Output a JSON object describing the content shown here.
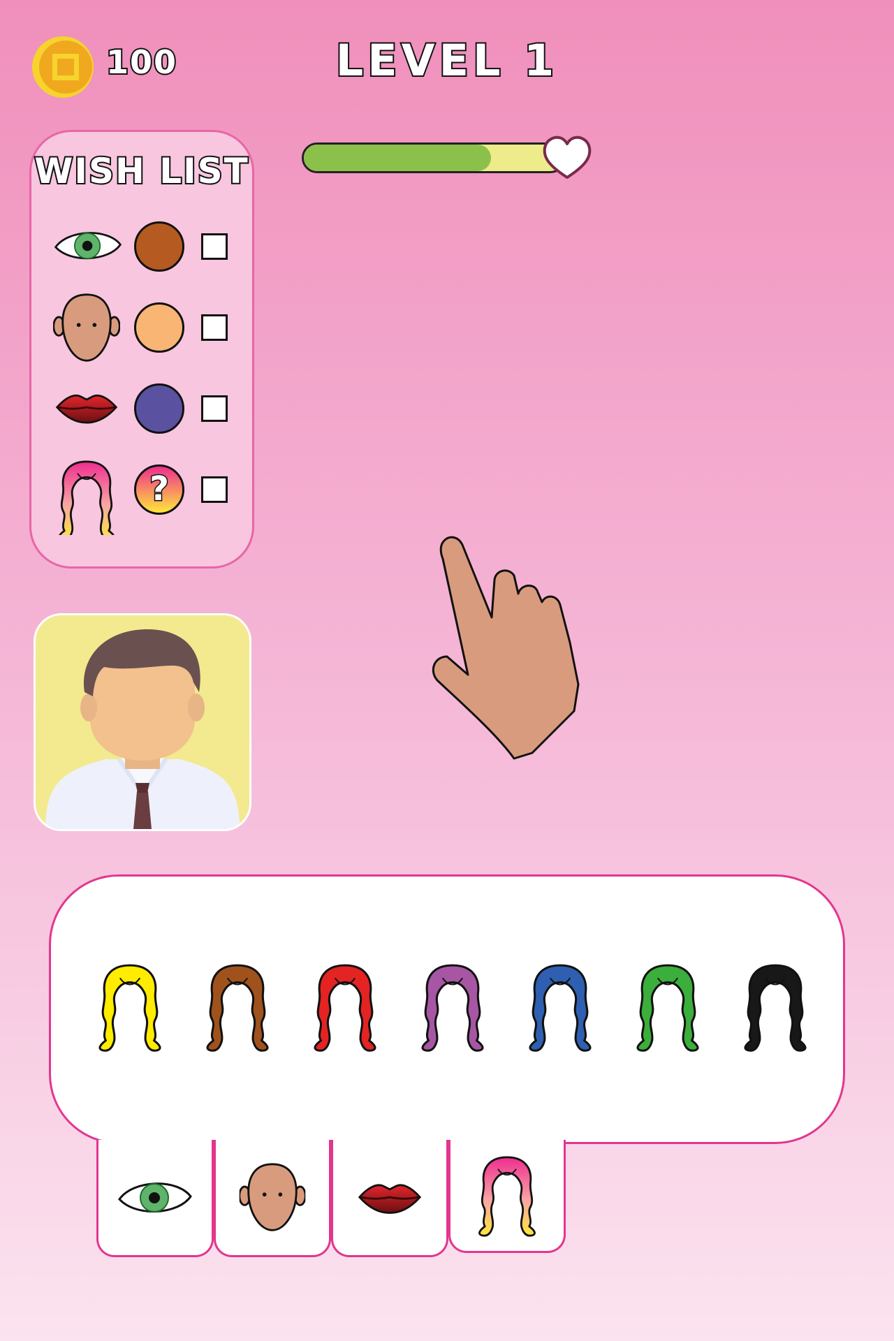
{
  "header": {
    "coins": "100",
    "level_title": "LEVEL 1"
  },
  "progress": {
    "value": 0.72
  },
  "wishlist": {
    "title": "WISH LIST",
    "items": [
      {
        "feature": "eye-icon",
        "color": "#b55a20",
        "swatch_icon": "",
        "checked": false
      },
      {
        "feature": "face-icon",
        "color": "#f8b574",
        "swatch_icon": "",
        "checked": false
      },
      {
        "feature": "lips-icon",
        "color": "#5a52a0",
        "swatch_icon": "",
        "checked": false
      },
      {
        "feature": "hair-icon",
        "color": "gradient-pink-yellow",
        "swatch_icon": "question-mark-icon",
        "checked": false
      }
    ],
    "unknown_symbol": "?"
  },
  "hair_options": [
    {
      "color": "#ffec00"
    },
    {
      "color": "#a0521c"
    },
    {
      "color": "#e42323"
    },
    {
      "color": "#a756a4"
    },
    {
      "color": "#2e5fb0"
    },
    {
      "color": "#3bae3b"
    },
    {
      "color": "#181818"
    }
  ],
  "tabs": [
    {
      "icon": "eye-icon"
    },
    {
      "icon": "face-icon"
    },
    {
      "icon": "lips-icon"
    },
    {
      "icon": "hair-icon",
      "active": true
    }
  ],
  "colors": {
    "background_top": "#f08fbb",
    "background_bottom": "#fbe3ef",
    "panel_border": "#e3368e",
    "progress_fill": "#8bc14a",
    "progress_track": "#eeeb8a"
  }
}
